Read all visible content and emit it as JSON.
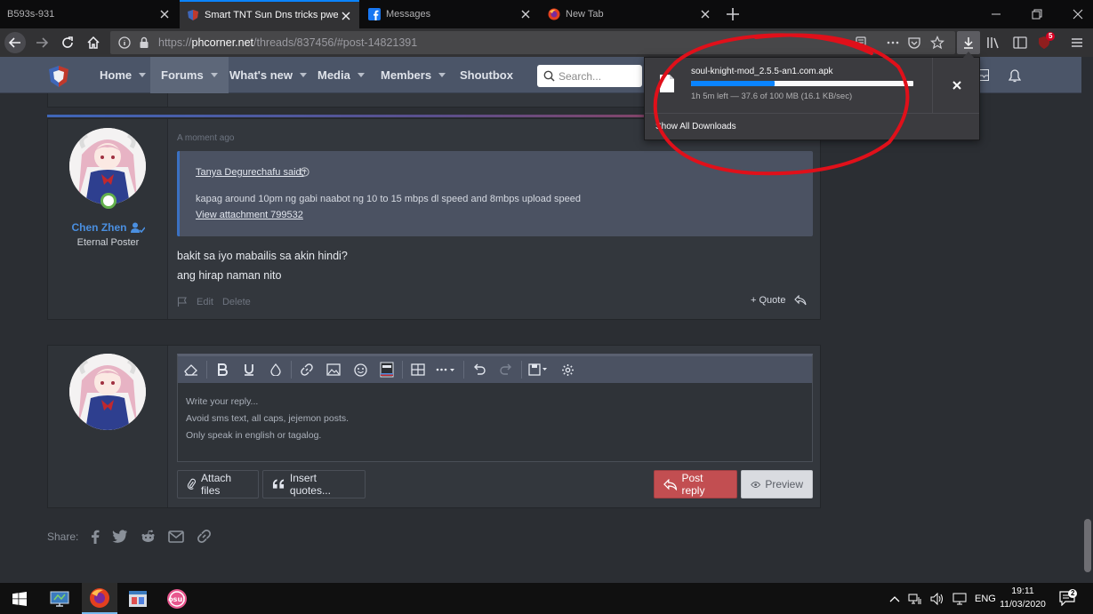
{
  "browser": {
    "tabs": [
      {
        "title": "B593s-931",
        "active": false
      },
      {
        "title": "Smart TNT Sun Dns tricks pwede",
        "active": true
      },
      {
        "title": "Messages",
        "active": false
      },
      {
        "title": "New Tab",
        "active": false
      }
    ],
    "url_prefix": "https://",
    "url_host": "phcorner.net",
    "url_path": "/threads/837456/#post-14821391",
    "extension_badge": "5"
  },
  "site": {
    "nav": [
      {
        "label": "Home",
        "caret": true
      },
      {
        "label": "Forums",
        "caret": true,
        "selected": true
      },
      {
        "label": "What's new",
        "caret": true
      },
      {
        "label": "Media",
        "caret": true
      },
      {
        "label": "Members",
        "caret": true
      },
      {
        "label": "Shoutbox",
        "caret": false
      }
    ],
    "search_placeholder": "Search..."
  },
  "post": {
    "date": "A moment ago",
    "username": "Chen Zhen",
    "user_title": "Eternal Poster",
    "quote_author": "Tanya Degurechafu said:",
    "quote_text": "kapag around 10pm ng gabi naabot ng 10 to 15 mbps dl speed and 8mbps upload speed",
    "quote_attachment": "View attachment 799532",
    "body_line1": "bakit sa iyo mabailis sa akin hindi?",
    "body_line2": "ang hirap naman nito",
    "edit_label": "Edit",
    "delete_label": "Delete",
    "quote_label": "+ Quote"
  },
  "reply": {
    "placeholder_line1": "Write your reply...",
    "placeholder_line2": "Avoid sms text, all caps, jejemon posts.",
    "placeholder_line3": "Only speak in english or tagalog.",
    "attach_label": "Attach files",
    "insert_quotes_label": "Insert quotes...",
    "post_reply_label": "Post reply",
    "preview_label": "Preview"
  },
  "share": {
    "label": "Share:"
  },
  "download": {
    "file_name": "soul-knight-mod_2.5.5-an1.com.apk",
    "status": "1h 5m left — 37.6 of 100 MB (16.1 KB/sec)",
    "progress": 0.376,
    "show_all_label": "Show All Downloads"
  },
  "taskbar": {
    "language": "ENG",
    "time": "19:11",
    "date": "11/03/2020"
  },
  "colors": {
    "accent_blue": "#0a84ff",
    "post_reply_red": "#c24e51",
    "username_blue": "#4a8fe0",
    "annotation_red": "#e0101a"
  }
}
